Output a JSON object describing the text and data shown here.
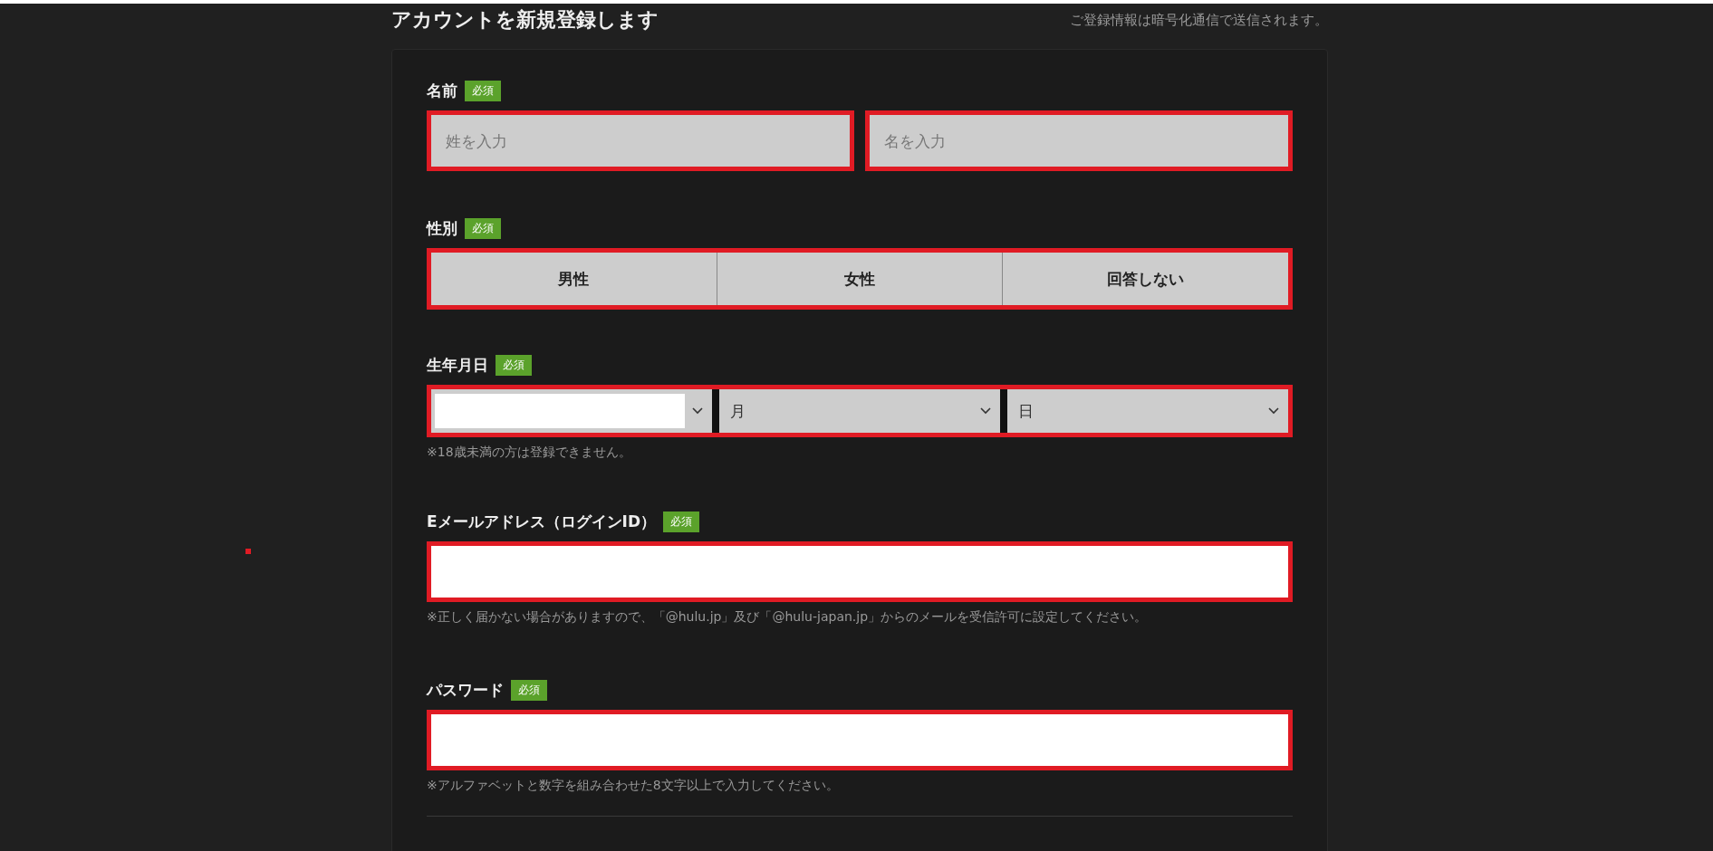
{
  "header": {
    "title": "アカウントを新規登録します",
    "notice": "ご登録情報は暗号化通信で送信されます。"
  },
  "fields": [
    {
      "kind": "name",
      "label": "名前",
      "badge": "必須",
      "inputs": [
        {
          "placeholder": "姓を入力"
        },
        {
          "placeholder": "名を入力"
        }
      ]
    },
    {
      "kind": "choice",
      "label": "性別",
      "badge": "必須",
      "options": [
        {
          "label": "男性",
          "selected": false
        },
        {
          "label": "女性",
          "selected": false
        },
        {
          "label": "回答しない",
          "selected": false
        }
      ]
    },
    {
      "kind": "date",
      "label": "生年月日",
      "badge": "必須",
      "selects": [
        {
          "redacted": true
        },
        {
          "value": "月",
          "redacted": false
        },
        {
          "value": "日",
          "redacted": false
        }
      ],
      "note": "※18歳未満の方は登録できません。"
    },
    {
      "kind": "text",
      "label": "Eメールアドレス（ログインID）",
      "badge": "必須",
      "note": "※正しく届かない場合がありますので、「@hulu.jp」及び「@hulu-japan.jp」からのメールを受信許可に設定してください。"
    },
    {
      "kind": "text",
      "label": "パスワード",
      "badge": "必須",
      "note": "※アルファベットと数字を組み合わせた8文字以上で入力してください。"
    }
  ]
}
